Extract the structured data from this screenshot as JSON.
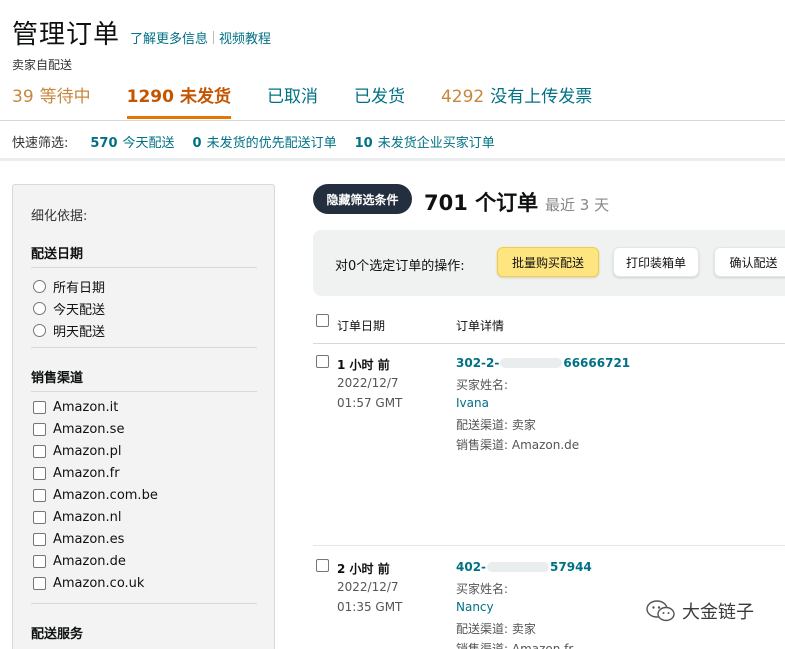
{
  "header": {
    "title": "管理订单",
    "learn_more": "了解更多信息",
    "video": "视频教程",
    "subtitle": "卖家自配送"
  },
  "status_tabs": [
    {
      "count": "39",
      "label": "等待中"
    },
    {
      "count": "1290",
      "label": "未发货"
    },
    {
      "count": "",
      "label": "已取消"
    },
    {
      "count": "",
      "label": "已发货"
    },
    {
      "count": "4292",
      "label": "没有上传发票"
    }
  ],
  "quick_filter": {
    "label": "快速筛选:",
    "items": [
      {
        "count": "570",
        "label": "今天配送"
      },
      {
        "count": "0",
        "label": "未发货的优先配送订单"
      },
      {
        "count": "10",
        "label": "未发货企业买家订单"
      }
    ]
  },
  "sidebar": {
    "heading": "细化依据:",
    "ship_date": {
      "title": "配送日期",
      "options": [
        "所有日期",
        "今天配送",
        "明天配送"
      ]
    },
    "sales_channel": {
      "title": "销售渠道",
      "options": [
        "Amazon.it",
        "Amazon.se",
        "Amazon.pl",
        "Amazon.fr",
        "Amazon.com.be",
        "Amazon.nl",
        "Amazon.es",
        "Amazon.de",
        "Amazon.co.uk"
      ]
    },
    "ship_service": {
      "title": "配送服务"
    }
  },
  "orders_summary": {
    "toggle_filters": "隐藏筛选条件",
    "count_text": "701 个订单",
    "range_text": "最近 3 天"
  },
  "actions": {
    "label": "对0个选定订单的操作:",
    "buy_shipping": "批量购买配送",
    "print_slips": "打印装箱单",
    "confirm_ship": "确认配送"
  },
  "table": {
    "col_date": "订单日期",
    "col_details": "订单详情",
    "rows": [
      {
        "ago": "1 小时 前",
        "date": "2022/12/7",
        "time": "01:57 GMT",
        "order_id_prefix": "302-2-",
        "order_id_suffix": "66666721",
        "buyer_name_label": "买家姓名:",
        "buyer": "Ivana",
        "ship_channel": "配送渠道: 卖家",
        "sales_channel": "销售渠道: Amazon.de"
      },
      {
        "ago": "2 小时 前",
        "date": "2022/12/7",
        "time": "01:35 GMT",
        "order_id_prefix": "402-",
        "order_id_suffix": "57944",
        "buyer_name_label": "买家姓名:",
        "buyer": "Nancy",
        "ship_channel": "配送渠道: 卖家",
        "sales_channel": "销售渠道: Amazon.fr"
      }
    ]
  },
  "watermark": {
    "text": "大金链子",
    "icon": "wechat-icon"
  }
}
